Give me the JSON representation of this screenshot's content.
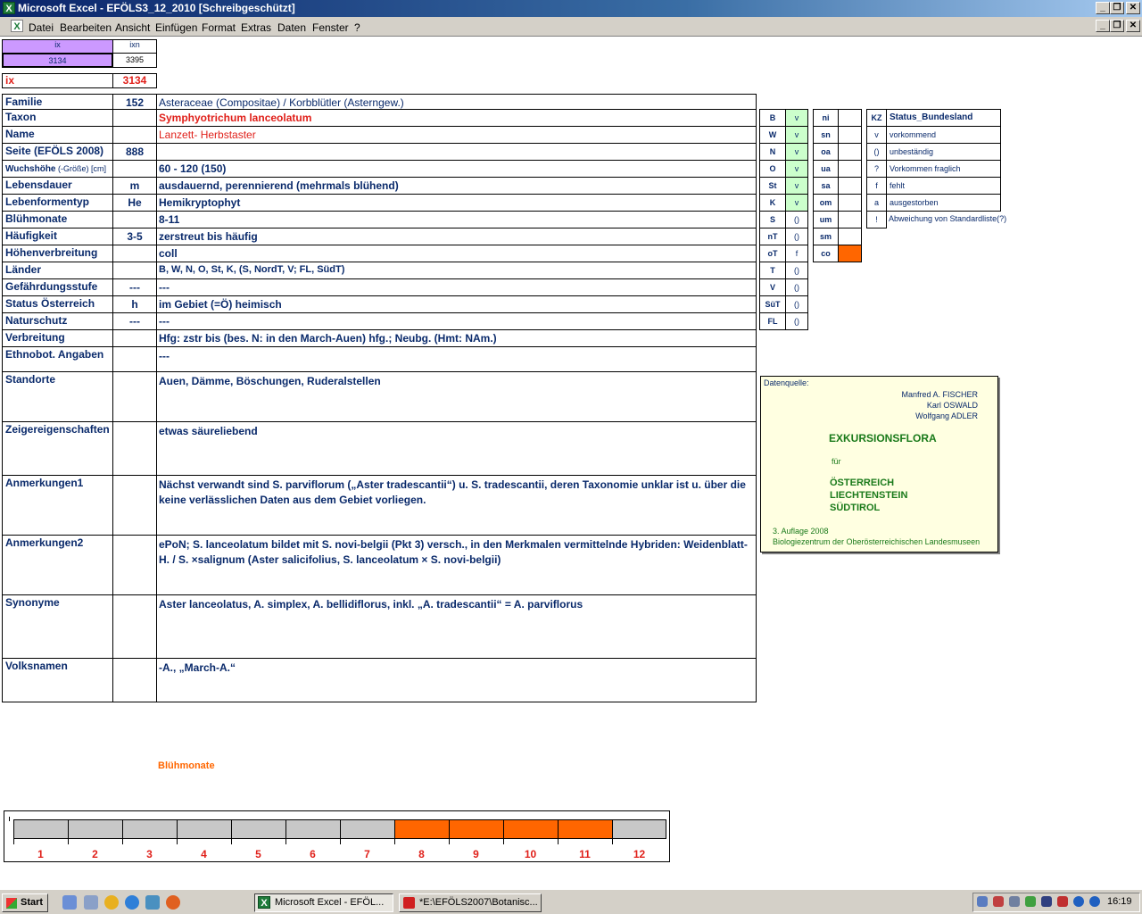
{
  "window": {
    "title": "Microsoft Excel - EFÖLS3_12_2010  [Schreibgeschützt]"
  },
  "menu": [
    "Datei",
    "Bearbeiten",
    "Ansicht",
    "Einfügen",
    "Format",
    "Extras",
    "Daten",
    "Fenster",
    "?"
  ],
  "index": {
    "ix_head": "ix",
    "ixn_head": "ixn",
    "ix_val": "3134",
    "ixn_val": "3395",
    "ix_label": "ix",
    "ix_big": "3134"
  },
  "rows": [
    {
      "label": "Familie",
      "num": "152",
      "value": "Asteraceae (Compositae)  /  Korbblütler (Asterngew.)"
    },
    {
      "label": "Taxon",
      "num": "",
      "value": "Symphyotrichum lanceolatum"
    },
    {
      "label": "Name",
      "num": "",
      "value": "Lanzett- Herbstaster"
    },
    {
      "label": "Seite (EFÖLS 2008)",
      "num": "888",
      "value": ""
    },
    {
      "label": "Wuchshöhe",
      "label_extra": " (-Größe) [cm]",
      "num": "",
      "value": " 60 - 120 (150)"
    },
    {
      "label": "Lebensdauer",
      "num": "m",
      "value": "ausdauernd, perennierend (mehrmals blühend)"
    },
    {
      "label": "Lebenformentyp",
      "num": "He",
      "value": "Hemikryptophyt"
    },
    {
      "label": "Blühmonate",
      "num": "",
      "value": " 8-11"
    },
    {
      "label": "Häufigkeit",
      "num": "3-5",
      "value": "zerstreut bis häufig"
    },
    {
      "label": "Höhenverbreitung",
      "num": "",
      "value": "coll"
    },
    {
      "label": "Länder",
      "num": "",
      "value": "B, W, N, O, St, K, (S, NordT, V; FL, SüdT)"
    },
    {
      "label": "Gefährdungsstufe",
      "num": "---",
      "value": "  ---"
    },
    {
      "label": "Status Österreich",
      "num": "h",
      "value": "im Gebiet (=Ö) heimisch"
    },
    {
      "label": "Naturschutz",
      "num": "---",
      "value": " ---"
    },
    {
      "label": "Verbreitung",
      "num": "",
      "value": "Hfg: zstr bis (bes. N: in den March-Auen) hfg.; Neubg. (Hmt: NAm.)"
    },
    {
      "label": "Ethnobot. Angaben",
      "num": "",
      "value": "---"
    },
    {
      "label": "Standorte",
      "num": "",
      "value": "Auen, Dämme, Böschungen, Ruderalstellen"
    },
    {
      "label": "Zeigereigenschaften",
      "num": "",
      "value": "etwas säureliebend"
    },
    {
      "label": "Anmerkungen1",
      "num": "",
      "value": "Nächst verwandt sind S. parviflorum („Aster tradescantii“) u. S. tradescantii, deren Taxonomie unklar ist u. über die keine verlässlichen Daten aus dem Gebiet vorliegen."
    },
    {
      "label": "Anmerkungen2",
      "num": "",
      "value": "ePoN; S. lanceolatum bildet mit S. novi-belgii (Pkt 3) versch., in den Merkmalen vermittelnde Hybriden: Weidenblatt-H. / S. ×salignum (Aster salicifolius, S. lanceolatum × S. novi-belgii)"
    },
    {
      "label": "Synonyme",
      "num": "",
      "value": "Aster lanceolatus, A. simplex, A. bellidiflorus, inkl. „A. tradescantii“ = A. parviflorus"
    },
    {
      "label": "Volksnamen",
      "num": "",
      "value": "-A., „March-A.“"
    }
  ],
  "states": [
    {
      "k": "B",
      "v": "v"
    },
    {
      "k": "W",
      "v": "v"
    },
    {
      "k": "N",
      "v": "v"
    },
    {
      "k": "O",
      "v": "v"
    },
    {
      "k": "St",
      "v": "v"
    },
    {
      "k": "K",
      "v": "v"
    },
    {
      "k": "S",
      "v": "()"
    },
    {
      "k": "nT",
      "v": "()"
    },
    {
      "k": "oT",
      "v": "f"
    },
    {
      "k": "T",
      "v": "()"
    },
    {
      "k": "V",
      "v": "()"
    },
    {
      "k": "SüT",
      "v": "()"
    },
    {
      "k": "FL",
      "v": "()"
    }
  ],
  "heights": [
    {
      "k": "ni",
      "v": ""
    },
    {
      "k": "sn",
      "v": ""
    },
    {
      "k": "oa",
      "v": ""
    },
    {
      "k": "ua",
      "v": ""
    },
    {
      "k": "sa",
      "v": ""
    },
    {
      "k": "om",
      "v": ""
    },
    {
      "k": "um",
      "v": ""
    },
    {
      "k": "sm",
      "v": ""
    },
    {
      "k": "co",
      "v": "c"
    }
  ],
  "legend": {
    "head_kz": "KZ",
    "head_status": "Status_Bundesland",
    "items": [
      {
        "kz": "v",
        "text": "vorkommend"
      },
      {
        "kz": "()",
        "text": "unbeständig"
      },
      {
        "kz": "?",
        "text": "Vorkommen fraglich"
      },
      {
        "kz": "f",
        "text": "fehlt"
      },
      {
        "kz": "a",
        "text": "ausgestorben"
      },
      {
        "kz": "!",
        "text": "Abweichung von Standardliste(?)"
      }
    ]
  },
  "source": {
    "label": "Datenquelle:",
    "authors": [
      "Manfred A. FISCHER",
      "Karl OSWALD",
      "Wolfgang ADLER"
    ],
    "title": "EXKURSIONSFLORA",
    "fuer": "für",
    "countries": [
      "ÖSTERREICH",
      "LIECHTENSTEIN",
      "SÜDTIROL"
    ],
    "edition": "3. Auflage 2008",
    "publisher": "Biologiezentrum der Oberösterreichischen Landesmuseen"
  },
  "bluehmonate": {
    "title": "Blühmonate",
    "months": [
      "1",
      "2",
      "3",
      "4",
      "5",
      "6",
      "7",
      "8",
      "9",
      "10",
      "11",
      "12"
    ],
    "active": [
      8,
      9,
      10,
      11
    ]
  },
  "taskbar": {
    "start": "Start",
    "task1": "Microsoft Excel - EFÖL...",
    "task2": "*E:\\EFÖLS2007\\Botanisc...",
    "clock": "16:19"
  },
  "colors": {
    "accent_orange": "#ff6600",
    "label_blue": "#0a2a6b",
    "taxon_red": "#e0201a",
    "green_cell": "#ccffcc",
    "purple": "#cc99ff"
  }
}
